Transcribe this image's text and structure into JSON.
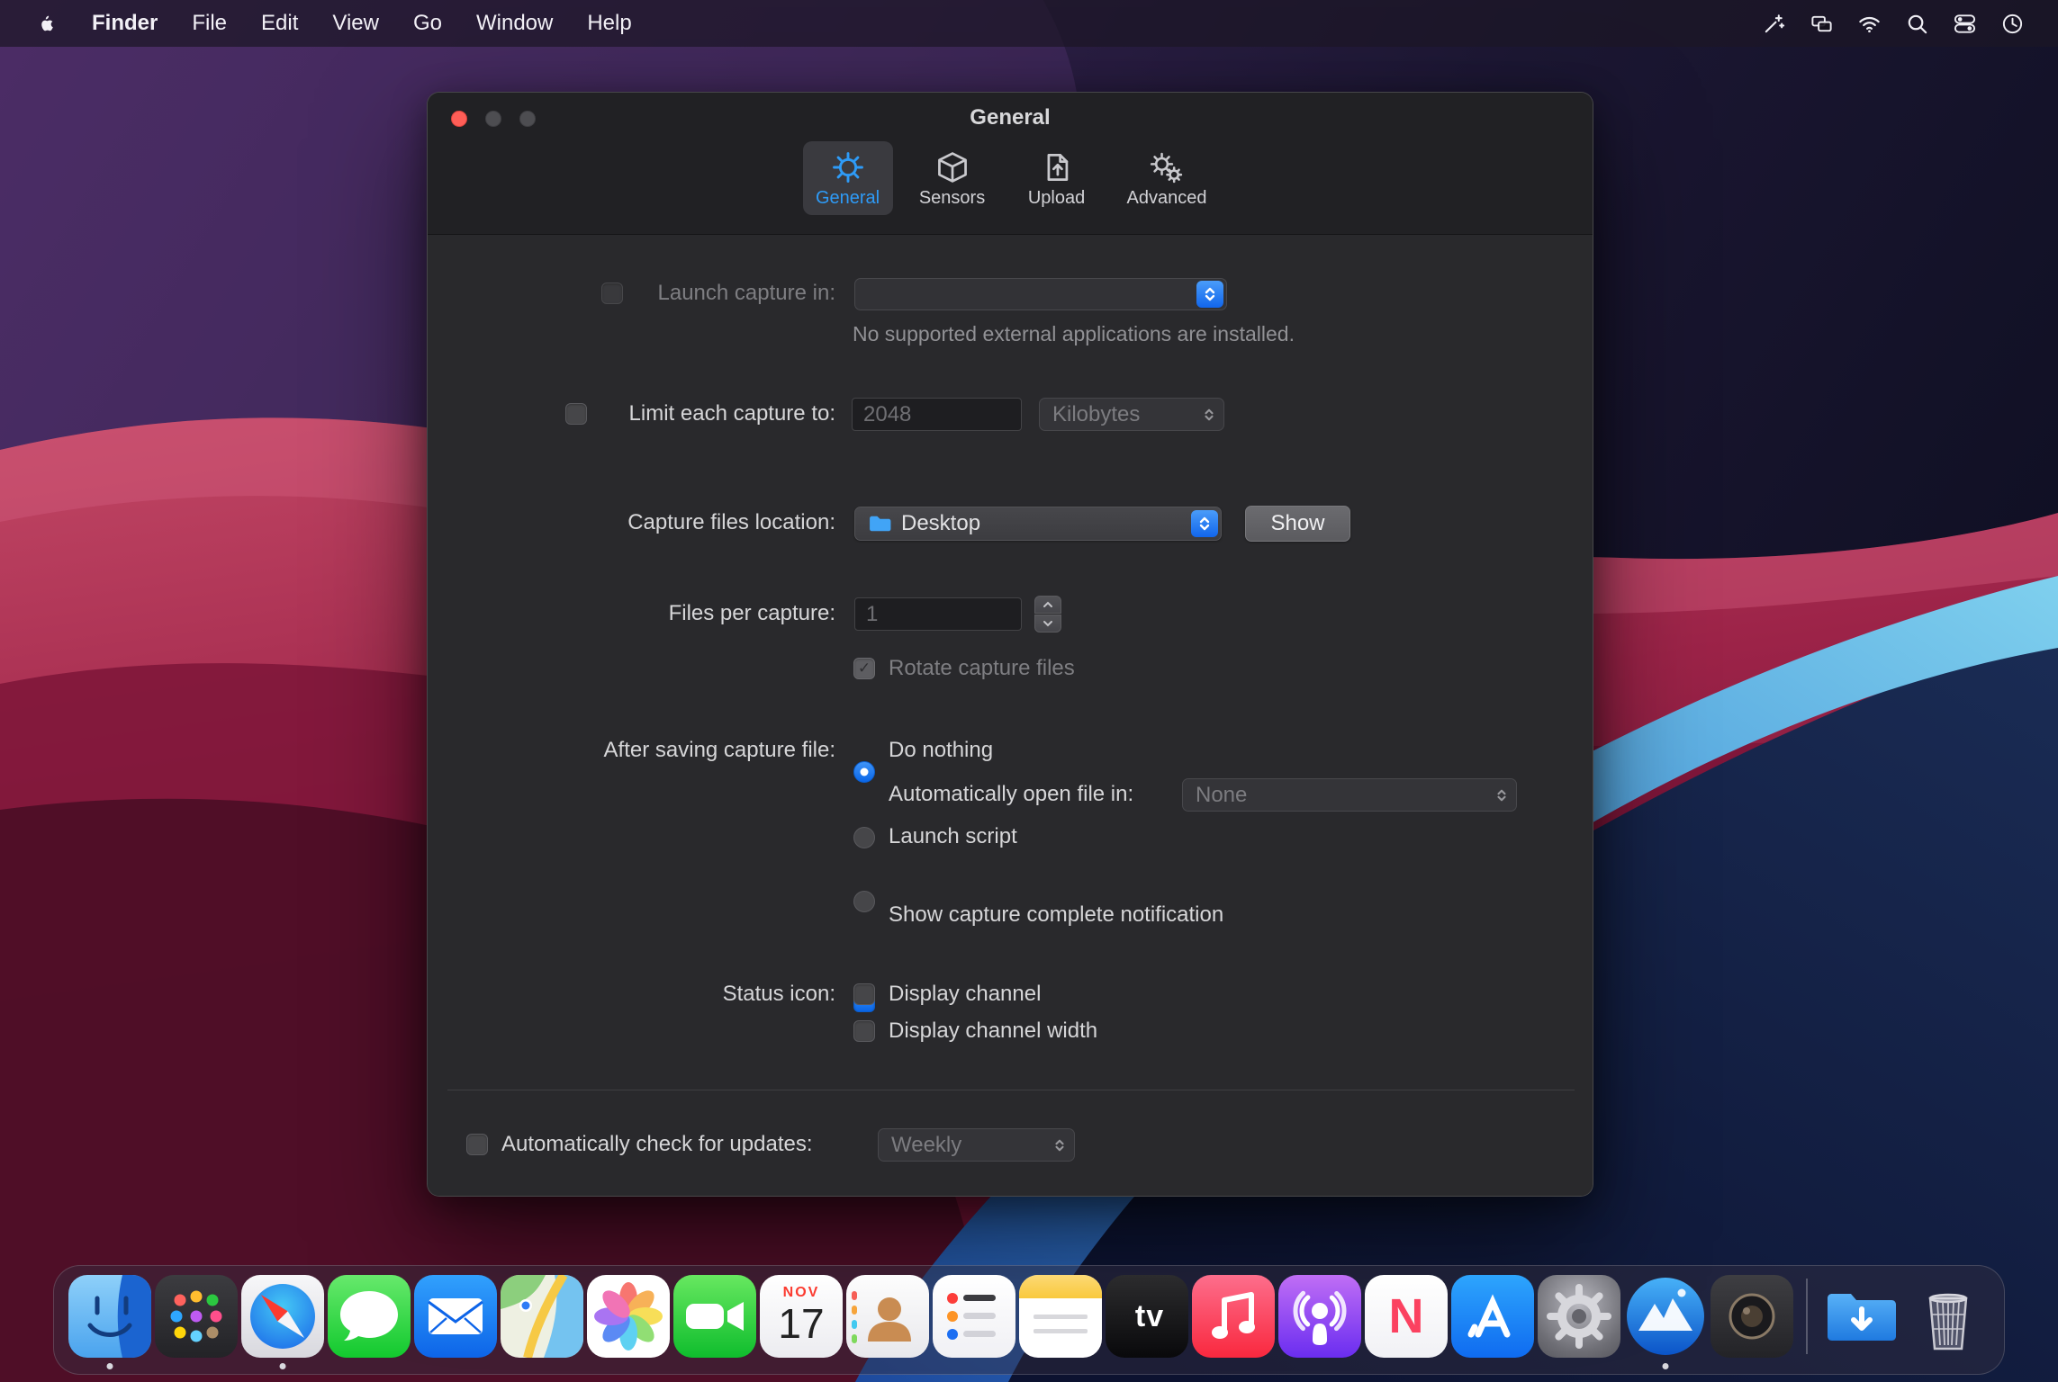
{
  "menu_bar": {
    "items": [
      {
        "label": "Finder",
        "bold": true
      },
      {
        "label": "File"
      },
      {
        "label": "Edit"
      },
      {
        "label": "View"
      },
      {
        "label": "Go"
      },
      {
        "label": "Window"
      },
      {
        "label": "Help"
      }
    ],
    "status_icons": [
      {
        "name": "wand-icon"
      },
      {
        "name": "displays-icon"
      },
      {
        "name": "wifi-icon"
      },
      {
        "name": "spotlight-icon"
      },
      {
        "name": "control-center-icon"
      },
      {
        "name": "clock-icon"
      }
    ]
  },
  "window": {
    "title": "General",
    "tabs": [
      {
        "label": "General",
        "icon": "gear-icon",
        "selected": true
      },
      {
        "label": "Sensors",
        "icon": "cube-icon",
        "selected": false
      },
      {
        "label": "Upload",
        "icon": "upload-doc-icon",
        "selected": false
      },
      {
        "label": "Advanced",
        "icon": "gears-icon",
        "selected": false
      }
    ],
    "form": {
      "launch_capture": {
        "label": "Launch capture in:",
        "checked": false,
        "dropdown_value": "",
        "note": "No supported external applications are installed."
      },
      "limit_capture": {
        "label": "Limit each capture to:",
        "checked": false,
        "size_value": "2048",
        "unit_value": "Kilobytes"
      },
      "capture_location": {
        "label": "Capture files location:",
        "dropdown_value": "Desktop",
        "show_button": "Show"
      },
      "files_per_capture": {
        "label": "Files per capture:",
        "value": "1",
        "rotate_label": "Rotate capture files",
        "rotate_checked": true
      },
      "after_saving": {
        "label": "After saving capture file:",
        "options": [
          {
            "label": "Do nothing",
            "selected": true
          },
          {
            "label": "Automatically open file in:",
            "selected": false,
            "dropdown_value": "None"
          },
          {
            "label": "Launch script",
            "selected": false
          }
        ]
      },
      "notification": {
        "label": "Show capture complete notification",
        "checked": true
      },
      "status_icon": {
        "label": "Status icon:",
        "options": [
          {
            "label": "Display channel",
            "checked": false
          },
          {
            "label": "Display channel width",
            "checked": false
          }
        ]
      },
      "updates": {
        "label": "Automatically check for updates:",
        "checked": false,
        "dropdown_value": "Weekly"
      }
    }
  },
  "dock": {
    "items": [
      {
        "icon": "finder",
        "name": "Finder",
        "running": true
      },
      {
        "icon": "launchpad",
        "name": "Launchpad"
      },
      {
        "icon": "safari",
        "name": "Safari",
        "running": true
      },
      {
        "icon": "messages",
        "name": "Messages"
      },
      {
        "icon": "mail",
        "name": "Mail"
      },
      {
        "icon": "maps",
        "name": "Maps"
      },
      {
        "icon": "photos",
        "name": "Photos"
      },
      {
        "icon": "facetime",
        "name": "FaceTime"
      },
      {
        "icon": "calendar",
        "name": "Calendar",
        "month": "NOV",
        "day": "17"
      },
      {
        "icon": "contacts",
        "name": "Contacts"
      },
      {
        "icon": "reminders",
        "name": "Reminders"
      },
      {
        "icon": "notes",
        "name": "Notes"
      },
      {
        "icon": "tv",
        "name": "TV",
        "letter": "tv"
      },
      {
        "icon": "music",
        "name": "Music"
      },
      {
        "icon": "podcasts",
        "name": "Podcasts"
      },
      {
        "icon": "news",
        "name": "News",
        "letter": "N"
      },
      {
        "icon": "appstore",
        "name": "App Store"
      },
      {
        "icon": "sysprefs",
        "name": "System Preferences"
      },
      {
        "icon": "capture",
        "name": "Capture App",
        "running": true
      },
      {
        "icon": "darkapp",
        "name": "Utility App"
      },
      {
        "icon": "separator",
        "name": "separator"
      },
      {
        "icon": "downloads",
        "name": "Downloads"
      },
      {
        "icon": "trash",
        "name": "Trash"
      }
    ]
  },
  "colors": {
    "accent": "#0A84FF",
    "window_bg": "#29292c",
    "menu_bar_bg": "rgba(28,22,38,0.72)"
  }
}
